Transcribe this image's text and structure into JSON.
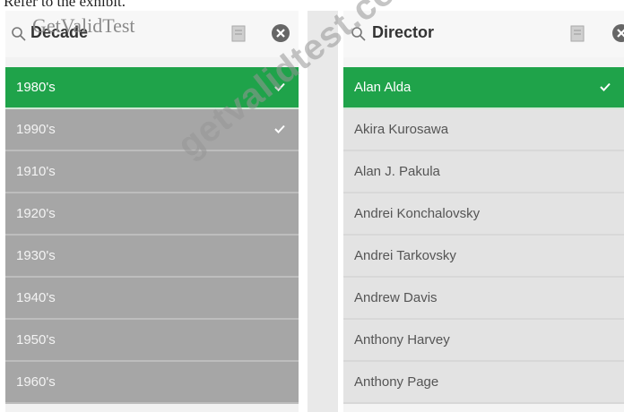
{
  "caption": "Refer to the exhibit.",
  "logo_text": "GetValidTest",
  "watermark": "getvalidtest.com",
  "colors": {
    "selected": "#1fa34a",
    "possible_left": "#a6a6a6",
    "possible_right": "#e3e3e3"
  },
  "decade_panel": {
    "title": "Decade",
    "icons": {
      "search": "search-icon",
      "clip": "clipboard-icon",
      "clear": "close-circle-icon",
      "check": "checkmark-icon"
    },
    "items": [
      {
        "label": "1980's",
        "state": "selected",
        "checked": true
      },
      {
        "label": "1990's",
        "state": "possible",
        "checked": true
      },
      {
        "label": "1910's",
        "state": "possible",
        "checked": false
      },
      {
        "label": "1920's",
        "state": "possible",
        "checked": false
      },
      {
        "label": "1930's",
        "state": "possible",
        "checked": false
      },
      {
        "label": "1940's",
        "state": "possible",
        "checked": false
      },
      {
        "label": "1950's",
        "state": "possible",
        "checked": false
      },
      {
        "label": "1960's",
        "state": "possible",
        "checked": false
      }
    ]
  },
  "director_panel": {
    "title": "Director",
    "icons": {
      "search": "search-icon",
      "clip": "clipboard-icon",
      "clear": "close-circle-icon",
      "check": "checkmark-icon"
    },
    "items": [
      {
        "label": "Alan Alda",
        "state": "selected",
        "checked": true
      },
      {
        "label": "Akira Kurosawa",
        "state": "possible",
        "checked": false
      },
      {
        "label": "Alan J. Pakula",
        "state": "possible",
        "checked": false
      },
      {
        "label": "Andrei Konchalovsky",
        "state": "possible",
        "checked": false
      },
      {
        "label": "Andrei Tarkovsky",
        "state": "possible",
        "checked": false
      },
      {
        "label": "Andrew Davis",
        "state": "possible",
        "checked": false
      },
      {
        "label": "Anthony Harvey",
        "state": "possible",
        "checked": false
      },
      {
        "label": "Anthony Page",
        "state": "possible",
        "checked": false
      }
    ]
  }
}
